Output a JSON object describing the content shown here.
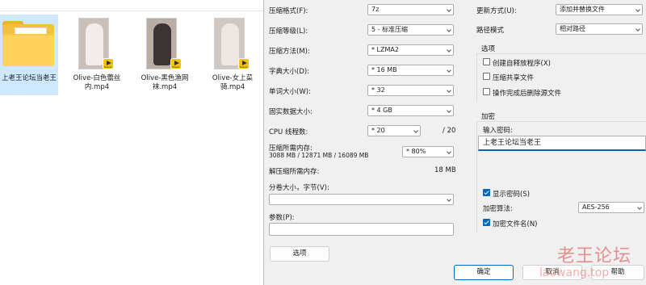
{
  "explorer": {
    "files": [
      {
        "name": "上老王论坛当老王",
        "type": "folder"
      },
      {
        "name": "Olive-白色蕾丝内.mp4",
        "type": "video",
        "badge": "Player"
      },
      {
        "name": "Olive-黑色渔网袜.mp4",
        "type": "video",
        "badge": "Player"
      },
      {
        "name": "Olive-女上菜骑.mp4",
        "type": "video",
        "badge": "Player"
      }
    ]
  },
  "dialog": {
    "left": {
      "format_label": "压缩格式(F):",
      "format_value": "7z",
      "level_label": "压缩等级(L):",
      "level_value": "5 - 标准压缩",
      "method_label": "压缩方法(M):",
      "method_value": "* LZMA2",
      "dict_label": "字典大小(D):",
      "dict_value": "* 16 MB",
      "word_label": "单词大小(W):",
      "word_value": "* 32",
      "solid_label": "固实数据大小:",
      "solid_value": "* 4 GB",
      "threads_label": "CPU 线程数:",
      "threads_value": "* 20",
      "threads_max": "/ 20",
      "mem_comp_label": "压缩所需内存:",
      "mem_comp_detail": "3088 MB / 12871 MB / 16089 MB",
      "mem_comp_value": "* 80%",
      "mem_decomp_label": "解压缩所需内存:",
      "mem_decomp_value": "18 MB",
      "split_label": "分卷大小，字节(V):",
      "split_value": "",
      "params_label": "参数(P):",
      "params_value": "",
      "options_button": "选项"
    },
    "right": {
      "update_label": "更新方式(U):",
      "update_value": "添加并替换文件",
      "path_label": "路径模式",
      "path_value": "相对路径",
      "options_group": "选项",
      "opt_sfx": "创建自释放程序(X)",
      "opt_shared": "压缩共享文件",
      "opt_delete": "操作完成后删除源文件",
      "encrypt_group": "加密",
      "password_label": "输入密码:",
      "password_value": "上老王论坛当老王",
      "show_password": "显示密码(S)",
      "enc_method_label": "加密算法:",
      "enc_method_value": "AES-256",
      "encrypt_names": "加密文件名(N)"
    },
    "buttons": {
      "ok": "确定",
      "cancel": "取消",
      "help": "帮助"
    },
    "state": {
      "opt_sfx": false,
      "opt_shared": false,
      "opt_delete": false,
      "show_password": true,
      "encrypt_names": true
    }
  },
  "watermark": {
    "text": "老王论坛",
    "subtext": "laowang.top"
  },
  "colors": {
    "accent": "#0067c0",
    "dialog_bg": "#f0f0f0",
    "selection": "#cde8ff",
    "watermark": "#e56e6e"
  }
}
